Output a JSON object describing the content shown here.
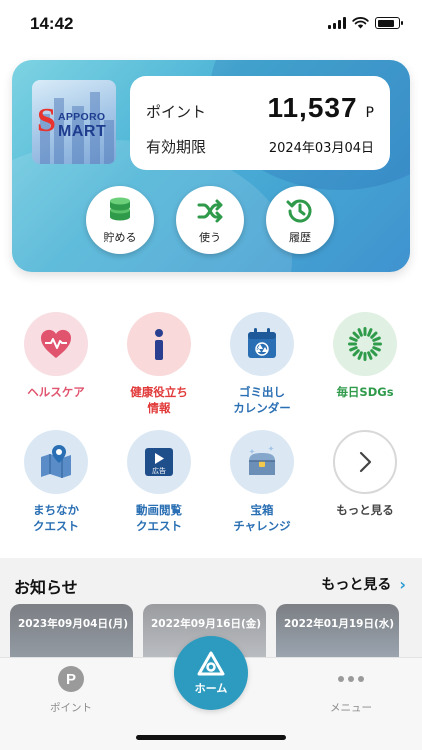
{
  "status_bar": {
    "time": "14:42"
  },
  "card": {
    "logo": {
      "letter_s": "S",
      "line1": "APPORO",
      "line2": "MART"
    },
    "points_label": "ポイント",
    "points_value": "11,537",
    "points_unit": "P",
    "expiry_label": "有効期限",
    "expiry_value": "2024年03月04日",
    "actions": [
      {
        "label": "貯める",
        "icon": "coins-icon"
      },
      {
        "label": "使う",
        "icon": "shuffle-icon"
      },
      {
        "label": "履歴",
        "icon": "history-icon"
      }
    ]
  },
  "features": [
    {
      "label": "ヘルスケア",
      "icon": "heart-pulse-icon",
      "color": "#e0546e",
      "bg": "#f8dde3"
    },
    {
      "label": "健康役立ち\n情報",
      "icon": "info-icon",
      "color": "#e23a3a",
      "bg": "#f9d9da"
    },
    {
      "label": "ゴミ出し\nカレンダー",
      "icon": "recycle-calendar-icon",
      "color": "#2a6fb3",
      "bg": "#dbe8f4"
    },
    {
      "label": "毎日SDGs",
      "icon": "sdgs-wheel-icon",
      "color": "#2e9a4a",
      "bg": "#e0f0e2"
    },
    {
      "label": "まちなか\nクエスト",
      "icon": "map-pin-icon",
      "color": "#2a6fb3",
      "bg": "#dbe8f4"
    },
    {
      "label": "動画閲覧\nクエスト",
      "icon": "video-ad-icon",
      "color": "#2a6fb3",
      "bg": "#dbe8f4"
    },
    {
      "label": "宝箱\nチャレンジ",
      "icon": "treasure-chest-icon",
      "color": "#2a6fb3",
      "bg": "#dbe8f4"
    },
    {
      "label": "もっと見る",
      "icon": "chevron-right-icon",
      "color": "#444444",
      "bg": "#ffffff"
    }
  ],
  "ad_label": "広告",
  "news": {
    "title": "お知らせ",
    "more_label": "もっと見る",
    "items": [
      {
        "date": "2023年09月04日(月)"
      },
      {
        "date": "2022年09月16日(金)"
      },
      {
        "date": "2022年01月19日(水)"
      }
    ]
  },
  "bottom_nav": {
    "point_icon_letter": "P",
    "point_label": "ポイント",
    "home_label": "ホーム",
    "menu_label": "メニュー"
  },
  "colors": {
    "accent": "#2c9bbf",
    "card_gradient_start": "#7dd3e2",
    "card_gradient_end": "#3f93cf"
  }
}
